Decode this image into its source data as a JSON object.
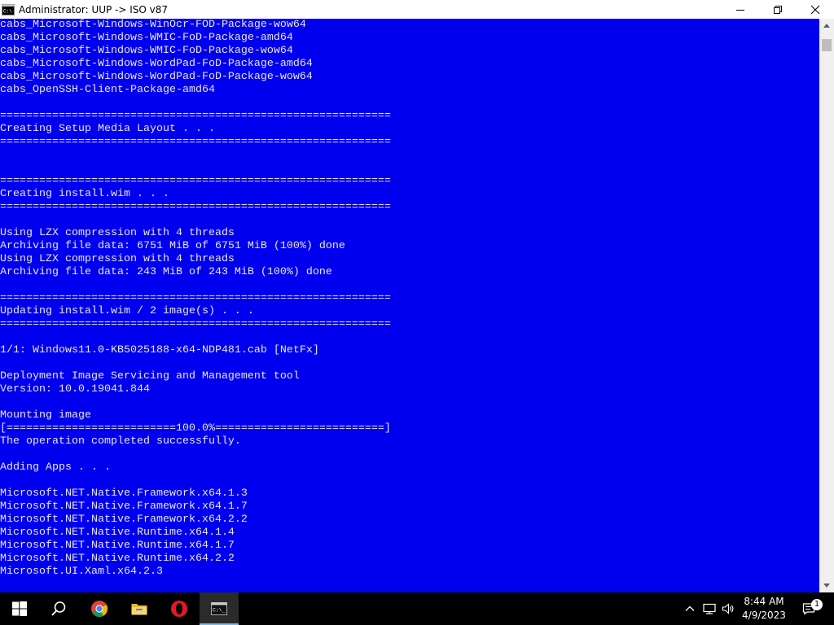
{
  "window": {
    "title": "Administrator:  UUP -> ISO v87",
    "icon": "cmd-icon"
  },
  "console_lines": [
    "cabs_Microsoft-Windows-WinOcr-FOD-Package-wow64",
    "cabs_Microsoft-Windows-WMIC-FoD-Package-amd64",
    "cabs_Microsoft-Windows-WMIC-FoD-Package-wow64",
    "cabs_Microsoft-Windows-WordPad-FoD-Package-amd64",
    "cabs_Microsoft-Windows-WordPad-FoD-Package-wow64",
    "cabs_OpenSSH-Client-Package-amd64",
    "",
    "============================================================",
    "Creating Setup Media Layout . . .",
    "============================================================",
    "",
    "",
    "============================================================",
    "Creating install.wim . . .",
    "============================================================",
    "",
    "Using LZX compression with 4 threads",
    "Archiving file data: 6751 MiB of 6751 MiB (100%) done",
    "Using LZX compression with 4 threads",
    "Archiving file data: 243 MiB of 243 MiB (100%) done",
    "",
    "============================================================",
    "Updating install.wim / 2 image(s) . . .",
    "============================================================",
    "",
    "1/1: Windows11.0-KB5025188-x64-NDP481.cab [NetFx]",
    "",
    "Deployment Image Servicing and Management tool",
    "Version: 10.0.19041.844",
    "",
    "Mounting image",
    "[==========================100.0%==========================]",
    "The operation completed successfully.",
    "",
    "Adding Apps . . .",
    "",
    "Microsoft.NET.Native.Framework.x64.1.3",
    "Microsoft.NET.Native.Framework.x64.1.7",
    "Microsoft.NET.Native.Framework.x64.2.2",
    "Microsoft.NET.Native.Runtime.x64.1.4",
    "Microsoft.NET.Native.Runtime.x64.1.7",
    "Microsoft.NET.Native.Runtime.x64.2.2",
    "Microsoft.UI.Xaml.x64.2.3"
  ],
  "taskbar": {
    "items": [
      "start-icon",
      "search-icon",
      "chrome-icon",
      "file-explorer-icon",
      "opera-icon",
      "cmd-icon"
    ],
    "active_item": "cmd-icon"
  },
  "tray": {
    "icons": [
      "chevron-up-icon",
      "network-icon",
      "volume-icon"
    ],
    "time": "8:44 AM",
    "date": "4/9/2023",
    "notification_count": "1"
  },
  "colors": {
    "console_bg": "#0000ee",
    "console_fg": "#e6e6e6",
    "taskbar_bg": "#000000",
    "accent": "#76b9ed"
  }
}
